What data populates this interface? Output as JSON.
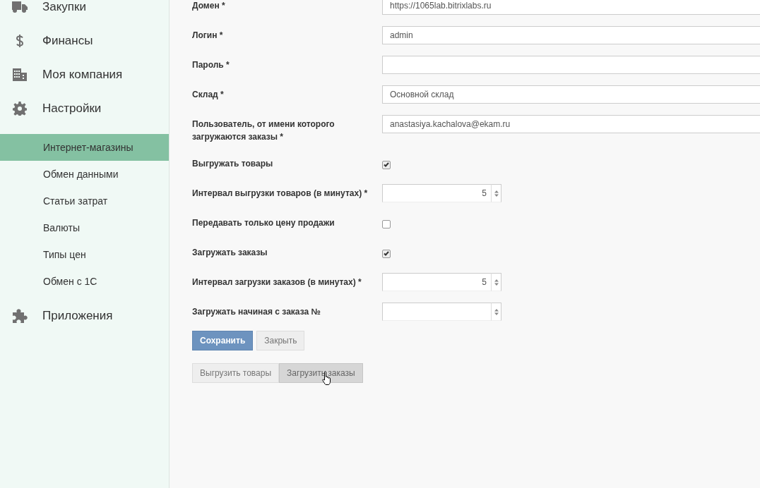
{
  "sidebar": {
    "items": [
      {
        "kind": "section",
        "label": "Закупки"
      },
      {
        "kind": "section",
        "label": "Финансы"
      },
      {
        "kind": "section",
        "label": "Моя компания"
      },
      {
        "kind": "section",
        "label": "Настройки"
      },
      {
        "kind": "sub",
        "label": "Интернет-магазины",
        "selected": true
      },
      {
        "kind": "sub",
        "label": "Обмен данными",
        "selected": false
      },
      {
        "kind": "sub",
        "label": "Статьи затрат",
        "selected": false
      },
      {
        "kind": "sub",
        "label": "Валюты",
        "selected": false
      },
      {
        "kind": "sub",
        "label": "Типы цен",
        "selected": false
      },
      {
        "kind": "sub",
        "label": "Обмен с 1С",
        "selected": false
      },
      {
        "kind": "section",
        "label": "Приложения"
      }
    ]
  },
  "form": {
    "fields": [
      {
        "kind": "text",
        "label": "Домен *",
        "value": "https://1065lab.bitrixlabs.ru"
      },
      {
        "kind": "text",
        "label": "Логин *",
        "value": "admin"
      },
      {
        "kind": "text",
        "label": "Пароль *"
      },
      {
        "kind": "text",
        "label": "Склад *",
        "value": "Основной склад"
      },
      {
        "kind": "text",
        "label": "Пользователь, от имени которого загружаются заказы *",
        "value": "anastasiya.kachalova@ekam.ru"
      },
      {
        "kind": "checkbox",
        "label": "Выгружать товары",
        "checked": true
      },
      {
        "kind": "number",
        "label": "Интервал выгрузки товаров (в минутах) *",
        "value": "5"
      },
      {
        "kind": "checkbox",
        "label": "Передавать только цену продажи",
        "checked": false
      },
      {
        "kind": "checkbox",
        "label": "Загружать заказы",
        "checked": true
      },
      {
        "kind": "number",
        "label": "Интервал загрузки заказов (в минутах) *",
        "value": "5"
      },
      {
        "kind": "number",
        "label": "Загружать начиная с заказа №"
      }
    ],
    "buttons": [
      {
        "label": "Сохранить",
        "primary": true
      },
      {
        "label": "Закрыть",
        "primary": false
      }
    ],
    "actions": [
      {
        "label": "Выгрузить товары",
        "hovered": false
      },
      {
        "label": "Загрузить заказы",
        "hovered": true
      }
    ]
  }
}
